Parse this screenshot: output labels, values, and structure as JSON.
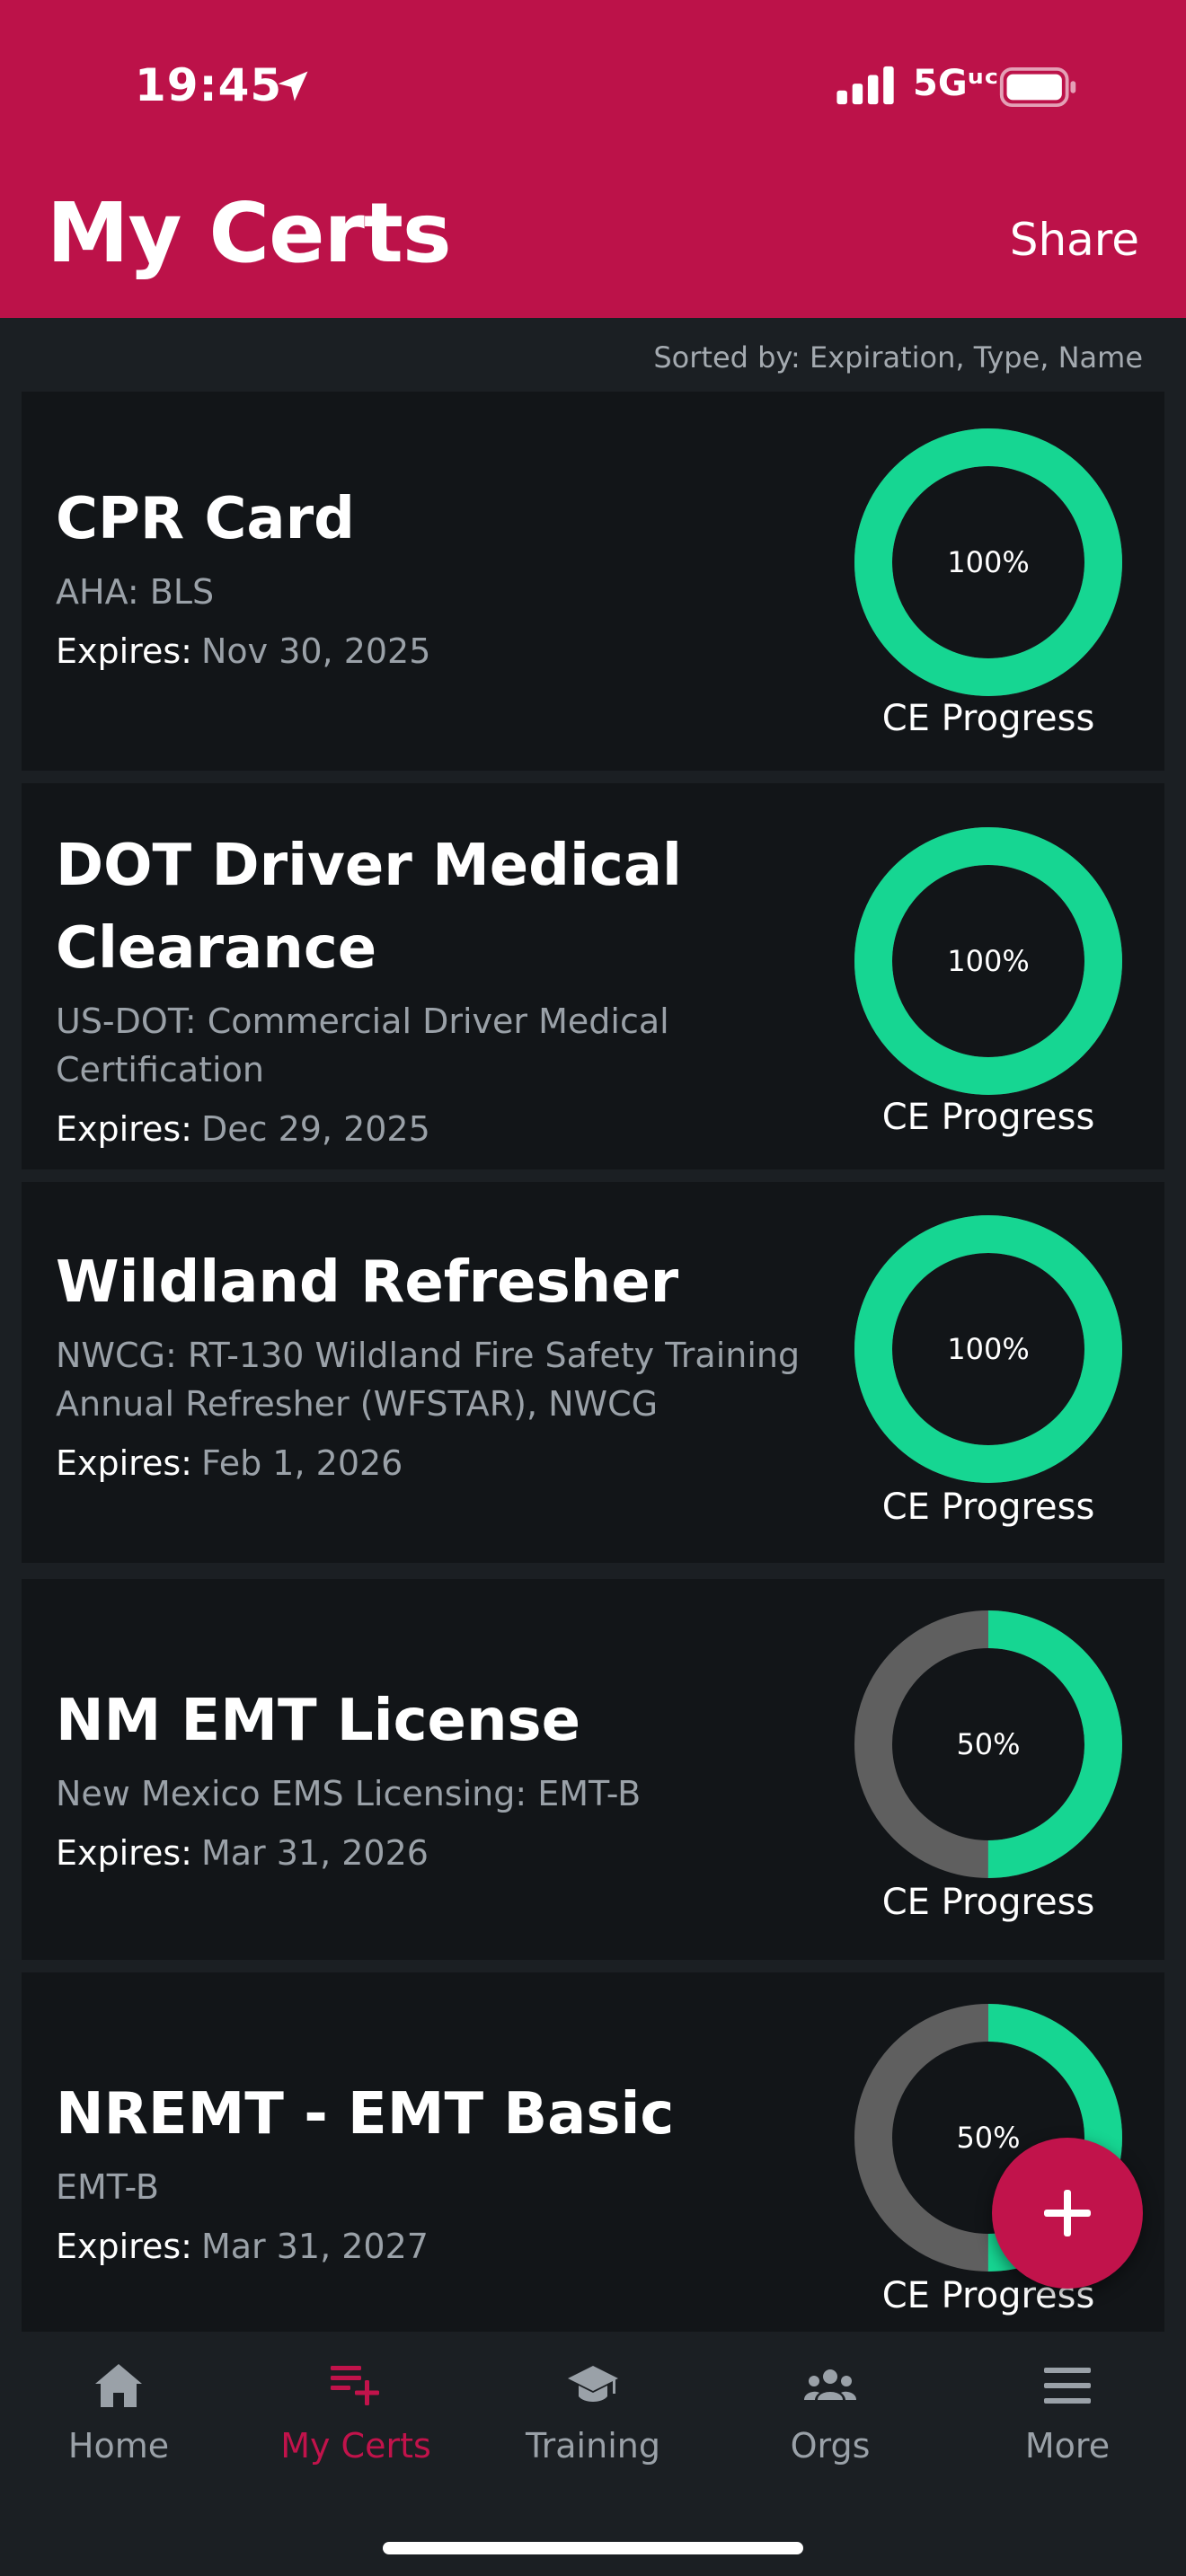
{
  "colors": {
    "brand": "#bc1249",
    "ring_complete": "#16d692",
    "ring_track": "#5f5f5f",
    "card_bg": "#121518",
    "page_bg": "#1b1f23"
  },
  "status_bar": {
    "time": "19:45",
    "network": "5Gᵘᶜ",
    "icons": [
      "location-arrow-icon",
      "signal-icon",
      "battery-icon"
    ]
  },
  "header": {
    "title": "My Certs",
    "share_label": "Share"
  },
  "sort_text": "Sorted by: Expiration, Type, Name",
  "certs": [
    {
      "name": "CPR Card",
      "subtitle": "AHA: BLS",
      "expires_label": "Expires:",
      "expires": "Nov 30, 2025",
      "progress": 100,
      "progress_text": "100%",
      "progress_label": "CE Progress"
    },
    {
      "name": "DOT Driver Medical Clearance",
      "subtitle": "US-DOT: Commercial Driver Medical Certification",
      "expires_label": "Expires:",
      "expires": "Dec 29, 2025",
      "progress": 100,
      "progress_text": "100%",
      "progress_label": "CE Progress"
    },
    {
      "name": "Wildland Refresher",
      "subtitle": "NWCG: RT-130 Wildland Fire Safety Training Annual Refresher (WFSTAR), NWCG",
      "expires_label": "Expires:",
      "expires": "Feb 1, 2026",
      "progress": 100,
      "progress_text": "100%",
      "progress_label": "CE Progress"
    },
    {
      "name": "NM EMT License",
      "subtitle": "New Mexico EMS Licensing: EMT-B",
      "expires_label": "Expires:",
      "expires": "Mar 31, 2026",
      "progress": 50,
      "progress_text": "50%",
      "progress_label": "CE Progress"
    },
    {
      "name": "NREMT - EMT Basic",
      "subtitle": "EMT-B",
      "expires_label": "Expires:",
      "expires": "Mar 31, 2027",
      "progress": 50,
      "progress_text": "50%",
      "progress_label": "CE Progress"
    }
  ],
  "fab": {
    "icon": "plus-icon"
  },
  "tabs": [
    {
      "label": "Home",
      "icon": "home-icon",
      "active": false
    },
    {
      "label": "My Certs",
      "icon": "list-add-icon",
      "active": true
    },
    {
      "label": "Training",
      "icon": "graduation-cap-icon",
      "active": false
    },
    {
      "label": "Orgs",
      "icon": "users-icon",
      "active": false
    },
    {
      "label": "More",
      "icon": "menu-icon",
      "active": false
    }
  ]
}
